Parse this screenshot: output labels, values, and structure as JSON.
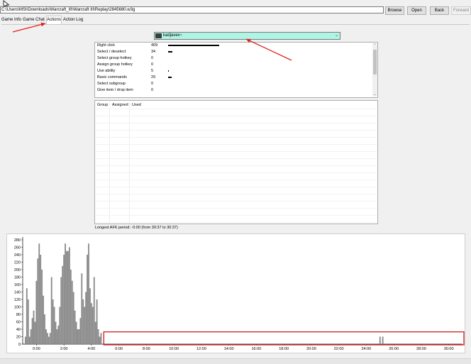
{
  "toolbar": {
    "path": "C:\\Users\\MSI\\Downloads\\Warcraft_III\\Warcraft III\\Replay\\2845680.w3g",
    "browse_label": "Browse",
    "open_label": "Open",
    "back_label": "Back",
    "forward_label": "Forward"
  },
  "tabs": [
    "Game Info",
    "Game Chat",
    "Actions",
    "Action Log"
  ],
  "active_tab": "Actions",
  "player_select": {
    "selected": "kadjavex~"
  },
  "actions": [
    {
      "name": "Right click",
      "count": 409
    },
    {
      "name": "Select / deselect",
      "count": 34
    },
    {
      "name": "Select group hotkey",
      "count": 0
    },
    {
      "name": "Assign group hotkey",
      "count": 0
    },
    {
      "name": "Use ability",
      "count": 5
    },
    {
      "name": "Basic commands",
      "count": 29
    },
    {
      "name": "Select subgroup",
      "count": 0
    },
    {
      "name": "Give item / drop item",
      "count": 0
    }
  ],
  "group_table": {
    "columns": [
      "Group",
      "Assigned",
      "Used"
    ]
  },
  "afk_text": "Longest AFK period: -0:00 (from 30:37 to 30:37)",
  "chart_data": {
    "type": "bar",
    "y_ticks": [
      "280",
      "260",
      "240",
      "220",
      "200",
      "180",
      "160",
      "140",
      "120",
      "100",
      "80",
      "60",
      "40",
      "20",
      "0"
    ],
    "x_ticks": [
      "0:00",
      "2:00",
      "4:00",
      "6:00",
      "8:00",
      "10:00",
      "12:00",
      "14:00",
      "16:00",
      "18:00",
      "20:00",
      "22:00",
      "24:00",
      "26:00",
      "28:00",
      "30:00"
    ],
    "ylim": [
      0,
      280
    ],
    "xlim_minutes": [
      -1,
      31
    ],
    "minutes": [
      -0.8,
      -0.7,
      -0.6,
      -0.5,
      -0.4,
      -0.3,
      -0.2,
      -0.1,
      0,
      0.1,
      0.2,
      0.3,
      0.4,
      0.5,
      0.6,
      0.7,
      0.8,
      0.9,
      1,
      1.1,
      1.2,
      1.3,
      1.4,
      1.5,
      1.6,
      1.7,
      1.8,
      1.9,
      2,
      2.1,
      2.2,
      2.3,
      2.4,
      2.5,
      2.6,
      2.7,
      2.8,
      2.9,
      3,
      3.1,
      3.2,
      3.3,
      3.4,
      3.5,
      3.6,
      3.7,
      3.8,
      3.9,
      4,
      4.1,
      4.2,
      4.3,
      4.4,
      4.5,
      4.6,
      4.7,
      25.0,
      25.2
    ],
    "values": [
      20,
      150,
      120,
      20,
      40,
      70,
      90,
      60,
      170,
      230,
      270,
      240,
      200,
      130,
      80,
      40,
      30,
      20,
      30,
      180,
      120,
      100,
      60,
      40,
      50,
      100,
      180,
      210,
      240,
      270,
      250,
      250,
      260,
      200,
      170,
      140,
      90,
      60,
      40,
      40,
      70,
      190,
      120,
      100,
      140,
      240,
      270,
      150,
      110,
      100,
      180,
      60,
      120,
      40,
      20,
      30,
      20,
      20
    ],
    "bar_color": "#888888",
    "highlight_box_color": "#d12b2b"
  },
  "annotation_color": "#e02020"
}
